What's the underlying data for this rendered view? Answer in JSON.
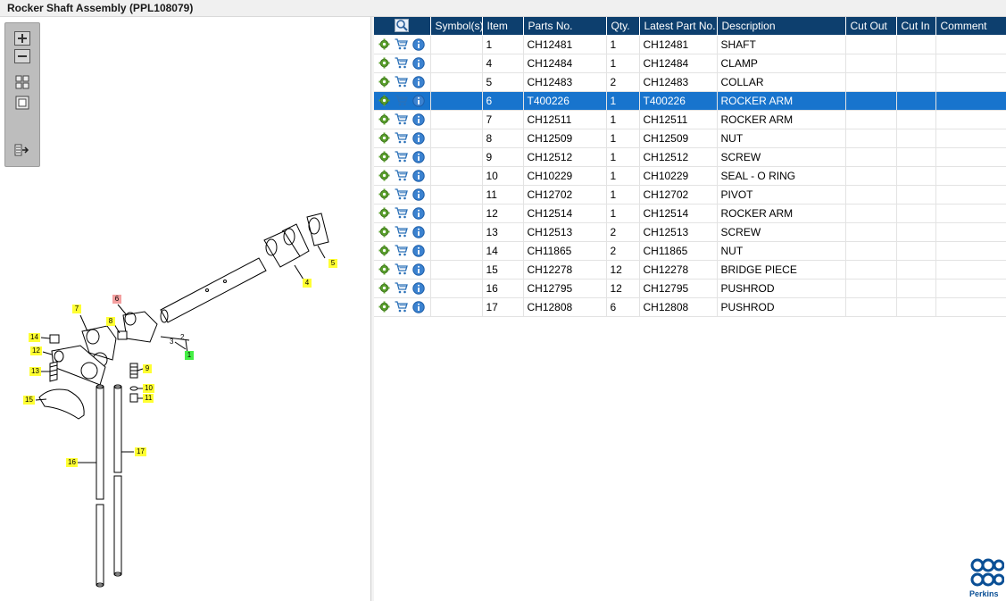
{
  "window": {
    "title": "Rocker Shaft Assembly (PPL108079)"
  },
  "toolbox": {
    "buttons": [
      {
        "id": "zoom-in",
        "icon": "zoom-in-icon"
      },
      {
        "id": "zoom-out",
        "icon": "zoom-out-icon"
      },
      {
        "id": "fit-all",
        "icon": "fit-all-icon"
      },
      {
        "id": "fit-window",
        "icon": "fit-window-icon"
      },
      {
        "id": "export",
        "icon": "export-icon"
      }
    ]
  },
  "diagram": {
    "callouts": [
      {
        "label": "5",
        "color": "yellow"
      },
      {
        "label": "4",
        "color": "yellow"
      },
      {
        "label": "6",
        "color": "red"
      },
      {
        "label": "7",
        "color": "yellow"
      },
      {
        "label": "8",
        "color": "yellow"
      },
      {
        "label": "14",
        "color": "yellow"
      },
      {
        "label": "12",
        "color": "yellow"
      },
      {
        "label": "13",
        "color": "yellow"
      },
      {
        "label": "9",
        "color": "yellow"
      },
      {
        "label": "10",
        "color": "yellow"
      },
      {
        "label": "11",
        "color": "yellow"
      },
      {
        "label": "15",
        "color": "yellow"
      },
      {
        "label": "16",
        "color": "yellow"
      },
      {
        "label": "17",
        "color": "yellow"
      },
      {
        "label": "1",
        "color": "green"
      }
    ],
    "dimension_labels": [
      "3",
      "2"
    ]
  },
  "grid": {
    "columns": [
      "Symbol(s)",
      "Item",
      "Parts No.",
      "Qty.",
      "Latest Part No.",
      "Description",
      "Cut Out",
      "Cut In",
      "Comment"
    ],
    "selected_row": 3,
    "rows": [
      {
        "item": "1",
        "parts_no": "CH12481",
        "qty": "1",
        "latest": "CH12481",
        "desc": "SHAFT",
        "cut_out": "",
        "cut_in": "",
        "comment": ""
      },
      {
        "item": "4",
        "parts_no": "CH12484",
        "qty": "1",
        "latest": "CH12484",
        "desc": "CLAMP",
        "cut_out": "",
        "cut_in": "",
        "comment": ""
      },
      {
        "item": "5",
        "parts_no": "CH12483",
        "qty": "2",
        "latest": "CH12483",
        "desc": "COLLAR",
        "cut_out": "",
        "cut_in": "",
        "comment": ""
      },
      {
        "item": "6",
        "parts_no": "T400226",
        "qty": "1",
        "latest": "T400226",
        "desc": "ROCKER ARM",
        "cut_out": "",
        "cut_in": "",
        "comment": ""
      },
      {
        "item": "7",
        "parts_no": "CH12511",
        "qty": "1",
        "latest": "CH12511",
        "desc": "ROCKER ARM",
        "cut_out": "",
        "cut_in": "",
        "comment": ""
      },
      {
        "item": "8",
        "parts_no": "CH12509",
        "qty": "1",
        "latest": "CH12509",
        "desc": "NUT",
        "cut_out": "",
        "cut_in": "",
        "comment": ""
      },
      {
        "item": "9",
        "parts_no": "CH12512",
        "qty": "1",
        "latest": "CH12512",
        "desc": "SCREW",
        "cut_out": "",
        "cut_in": "",
        "comment": ""
      },
      {
        "item": "10",
        "parts_no": "CH10229",
        "qty": "1",
        "latest": "CH10229",
        "desc": "SEAL - O RING",
        "cut_out": "",
        "cut_in": "",
        "comment": ""
      },
      {
        "item": "11",
        "parts_no": "CH12702",
        "qty": "1",
        "latest": "CH12702",
        "desc": "PIVOT",
        "cut_out": "",
        "cut_in": "",
        "comment": ""
      },
      {
        "item": "12",
        "parts_no": "CH12514",
        "qty": "1",
        "latest": "CH12514",
        "desc": "ROCKER ARM",
        "cut_out": "",
        "cut_in": "",
        "comment": ""
      },
      {
        "item": "13",
        "parts_no": "CH12513",
        "qty": "2",
        "latest": "CH12513",
        "desc": "SCREW",
        "cut_out": "",
        "cut_in": "",
        "comment": ""
      },
      {
        "item": "14",
        "parts_no": "CH11865",
        "qty": "2",
        "latest": "CH11865",
        "desc": "NUT",
        "cut_out": "",
        "cut_in": "",
        "comment": ""
      },
      {
        "item": "15",
        "parts_no": "CH12278",
        "qty": "12",
        "latest": "CH12278",
        "desc": "BRIDGE PIECE",
        "cut_out": "",
        "cut_in": "",
        "comment": ""
      },
      {
        "item": "16",
        "parts_no": "CH12795",
        "qty": "12",
        "latest": "CH12795",
        "desc": "PUSHROD",
        "cut_out": "",
        "cut_in": "",
        "comment": ""
      },
      {
        "item": "17",
        "parts_no": "CH12808",
        "qty": "6",
        "latest": "CH12808",
        "desc": "PUSHROD",
        "cut_out": "",
        "cut_in": "",
        "comment": ""
      }
    ]
  },
  "logo": {
    "text": "Perkins"
  },
  "colors": {
    "header": "#0d3f6e",
    "selected": "#1874cd",
    "callout": "#ffff33",
    "brand": "#0a4f95"
  }
}
